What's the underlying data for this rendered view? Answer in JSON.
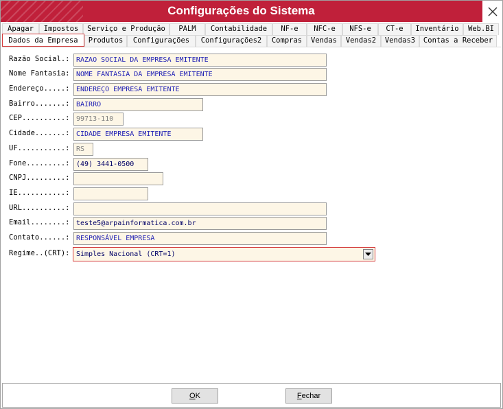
{
  "window": {
    "title": "Configurações do Sistema",
    "accent_color": "#c0203a"
  },
  "tabs": {
    "row1": [
      {
        "label": "Apagar",
        "id": "apagar"
      },
      {
        "label": "Impostos",
        "id": "impostos"
      },
      {
        "label": "Serviço e Produção",
        "id": "servico-producao"
      },
      {
        "label": "PALM",
        "id": "palm"
      },
      {
        "label": "Contabilidade",
        "id": "contabilidade"
      },
      {
        "label": "NF-e",
        "id": "nf-e"
      },
      {
        "label": "NFC-e",
        "id": "nfc-e"
      },
      {
        "label": "NFS-e",
        "id": "nfs-e"
      },
      {
        "label": "CT-e",
        "id": "ct-e"
      },
      {
        "label": "Inventário",
        "id": "inventario"
      },
      {
        "label": "Web.BI",
        "id": "web-bi"
      }
    ],
    "row2": [
      {
        "label": "Dados da Empresa",
        "id": "dados-empresa",
        "active": true
      },
      {
        "label": "Produtos",
        "id": "produtos"
      },
      {
        "label": "Configurações",
        "id": "configuracoes"
      },
      {
        "label": "Configurações2",
        "id": "configuracoes2"
      },
      {
        "label": "Compras",
        "id": "compras"
      },
      {
        "label": "Vendas",
        "id": "vendas"
      },
      {
        "label": "Vendas2",
        "id": "vendas2"
      },
      {
        "label": "Vendas3",
        "id": "vendas3"
      },
      {
        "label": "Contas a Receber",
        "id": "contas-receber"
      }
    ]
  },
  "form": {
    "razao_social": {
      "label": "Razão Social.:",
      "value": "RAZAO SOCIAL DA EMPRESA EMITENTE"
    },
    "nome_fantasia": {
      "label": "Nome Fantasia:",
      "value": "NOME FANTASIA DA EMPRESA EMITENTE"
    },
    "endereco": {
      "label": "Endereço.....:",
      "value": "ENDEREÇO EMPRESA EMITENTE"
    },
    "bairro": {
      "label": "Bairro.......:",
      "value": "BAIRRO"
    },
    "cep": {
      "label": "CEP..........:",
      "value": "99713-110"
    },
    "cidade": {
      "label": "Cidade.......:",
      "value": "CIDADE EMPRESA EMITENTE"
    },
    "uf": {
      "label": "UF...........:",
      "value": "RS"
    },
    "fone": {
      "label": "Fone.........:",
      "value": "(49) 3441-0500"
    },
    "cnpj": {
      "label": "CNPJ.........:",
      "value": ""
    },
    "ie": {
      "label": "IE...........:",
      "value": ""
    },
    "url": {
      "label": "URL..........:",
      "value": ""
    },
    "email": {
      "label": "Email........:",
      "value": "teste5@arpainformatica.com.br"
    },
    "contato": {
      "label": "Contato......:",
      "value": "RESPONSÁVEL EMPRESA"
    },
    "regime": {
      "label": "Regime..(CRT):",
      "value": "Simples Nacional (CRT=1)"
    }
  },
  "buttons": {
    "ok": {
      "first": "O",
      "rest": "K"
    },
    "fechar": {
      "first": "F",
      "rest": "echar"
    }
  }
}
